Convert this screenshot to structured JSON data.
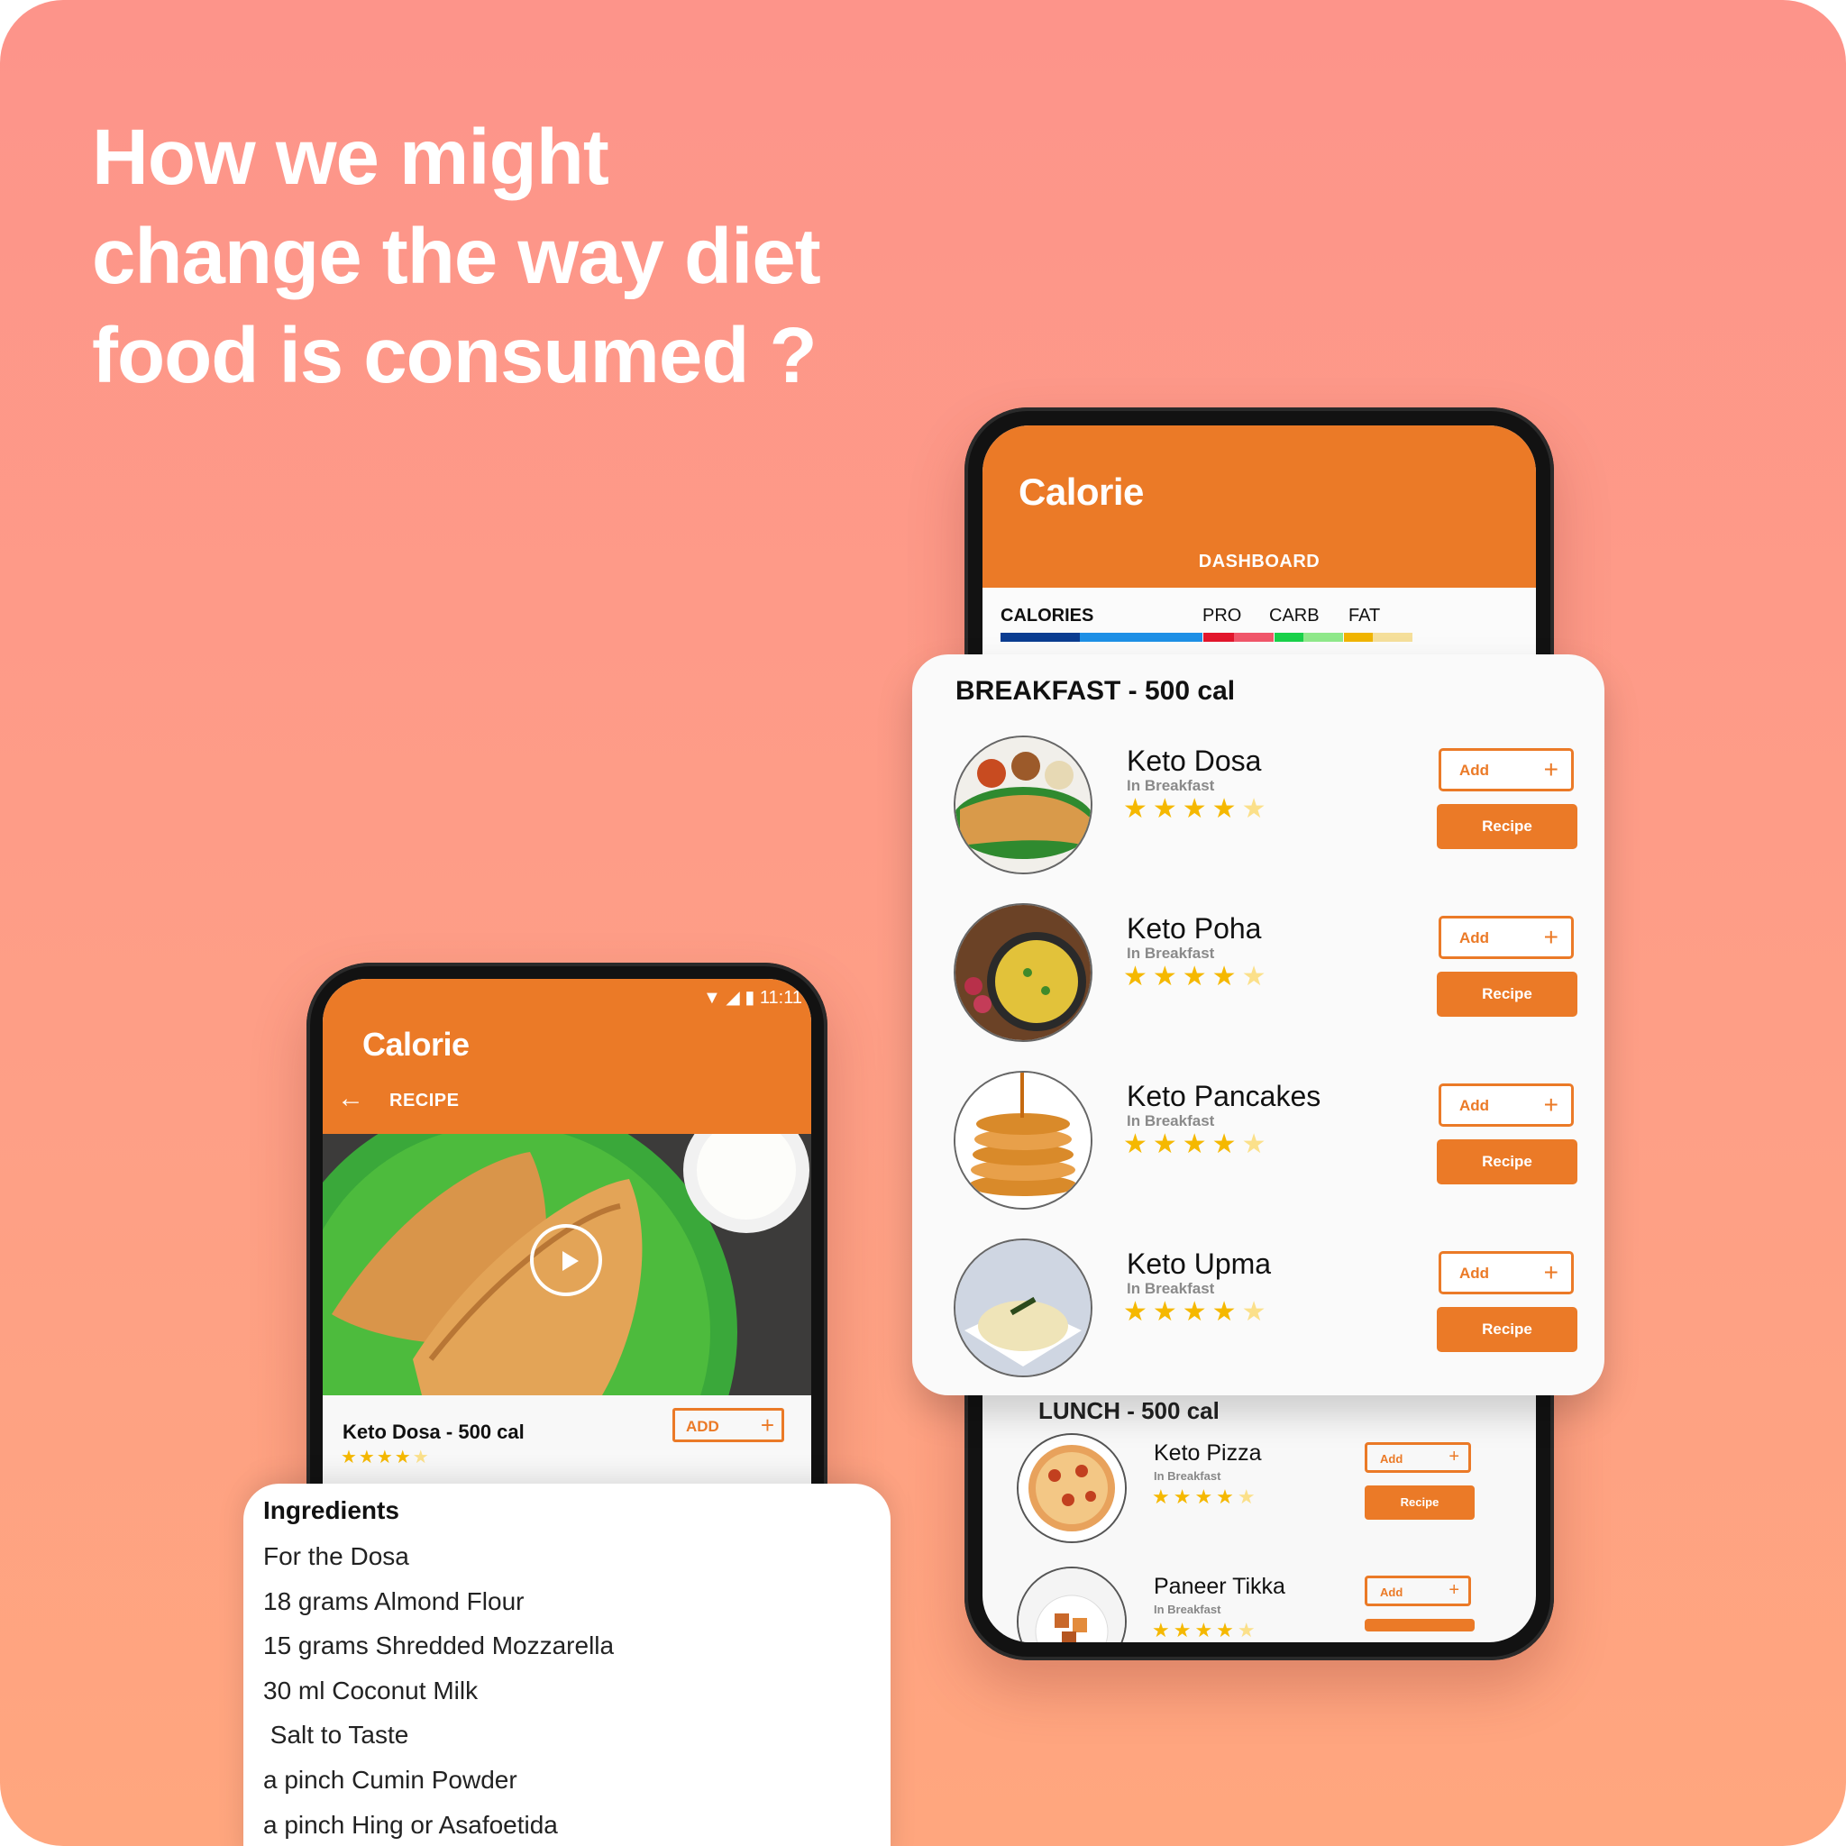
{
  "headline": "How we might\nchange the way diet\nfood is consumed ?",
  "app": {
    "brand": "Calorie",
    "accent": "#eb7a27"
  },
  "dashboard": {
    "title": "DASHBOARD",
    "macros": {
      "calories": "CALORIES",
      "pro": "PRO",
      "carb": "CARB",
      "fat": "FAT"
    }
  },
  "breakfast": {
    "title": "BREAKFAST - 500 cal",
    "add_label": "Add",
    "recipe_label": "Recipe",
    "items": [
      {
        "name": "Keto Dosa",
        "meal": "In Breakfast",
        "rating": 4
      },
      {
        "name": "Keto Poha",
        "meal": "In Breakfast",
        "rating": 4
      },
      {
        "name": "Keto Pancakes",
        "meal": "In Breakfast",
        "rating": 4
      },
      {
        "name": "Keto Upma",
        "meal": "In Breakfast",
        "rating": 4
      }
    ]
  },
  "lunch": {
    "title": "LUNCH - 500 cal",
    "items": [
      {
        "name": "Keto Pizza",
        "meal": "In Breakfast",
        "rating": 4
      },
      {
        "name": "Paneer Tikka",
        "meal": "In Breakfast",
        "rating": 4
      }
    ]
  },
  "recipe_screen": {
    "status_time": "11:11",
    "title": "RECIPE",
    "dish": "Keto Dosa  - 500 cal",
    "add_label": "ADD",
    "rating": 4
  },
  "ingredients": {
    "title": "Ingredients",
    "items": [
      "For the Dosa",
      "18 grams Almond Flour",
      "15 grams Shredded Mozzarella",
      "30 ml Coconut Milk",
      " Salt to Taste",
      "a pinch Cumin Powder",
      "a pinch Hing or Asafoetida"
    ]
  },
  "colors": {
    "calories_dark": "#0b3d91",
    "calories_light": "#1e90e6",
    "pro_dark": "#e2162c",
    "pro_light": "#f0566a",
    "carb_dark": "#19d14a",
    "carb_light": "#8fe88a",
    "fat_dark": "#f0b400",
    "fat_light": "#f5df9a"
  }
}
